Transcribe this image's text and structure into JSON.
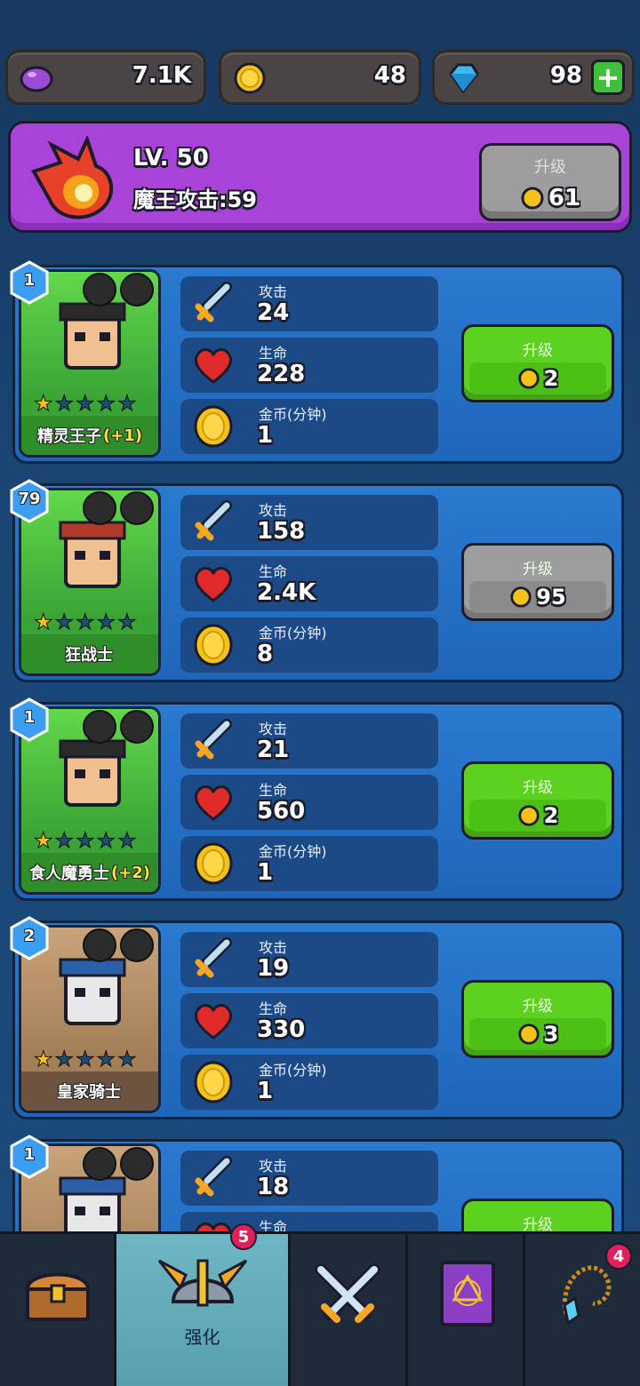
{
  "resources": {
    "purple": {
      "icon": "purple-orb-icon",
      "value": "7.1K"
    },
    "gold": {
      "icon": "gold-coin-icon",
      "value": "48"
    },
    "gems": {
      "icon": "diamond-icon",
      "value": "98",
      "add": "+"
    }
  },
  "boss_upgrade": {
    "level": "LV. 50",
    "attack_label": "魔王攻击:59",
    "button_label": "升级",
    "cost": "61"
  },
  "heroes": [
    {
      "badge": "1",
      "name": "精灵王子",
      "bonus": "(+1)",
      "stars_filled": 1,
      "stars_total": 5,
      "stats": {
        "atk_label": "攻击",
        "atk": "24",
        "hp_label": "生命",
        "hp": "228",
        "gold_label": "金币(分钟)",
        "gold": "1"
      },
      "upgrade_label": "升级",
      "cost": "2",
      "upgrade_enabled": true
    },
    {
      "badge": "79",
      "name": "狂战士",
      "bonus": "",
      "stars_filled": 1,
      "stars_total": 5,
      "stats": {
        "atk_label": "攻击",
        "atk": "158",
        "hp_label": "生命",
        "hp": "2.4K",
        "gold_label": "金币(分钟)",
        "gold": "8"
      },
      "upgrade_label": "升级",
      "cost": "95",
      "upgrade_enabled": false
    },
    {
      "badge": "1",
      "name": "食人魔勇士",
      "bonus": "(+2)",
      "stars_filled": 1,
      "stars_total": 5,
      "stats": {
        "atk_label": "攻击",
        "atk": "21",
        "hp_label": "生命",
        "hp": "560",
        "gold_label": "金币(分钟)",
        "gold": "1"
      },
      "upgrade_label": "升级",
      "cost": "2",
      "upgrade_enabled": true
    },
    {
      "badge": "2",
      "name": "皇家骑士",
      "bonus": "",
      "stars_filled": 1,
      "stars_total": 5,
      "stats": {
        "atk_label": "攻击",
        "atk": "19",
        "hp_label": "生命",
        "hp": "330",
        "gold_label": "金币(分钟)",
        "gold": "1"
      },
      "upgrade_label": "升级",
      "cost": "3",
      "upgrade_enabled": true
    },
    {
      "badge": "1",
      "name": "",
      "bonus": "",
      "stars_filled": 1,
      "stars_total": 5,
      "stats": {
        "atk_label": "攻击",
        "atk": "18",
        "hp_label": "生命",
        "hp": "",
        "gold_label": "",
        "gold": ""
      },
      "upgrade_label": "升级",
      "cost": "",
      "upgrade_enabled": true
    }
  ],
  "nav": {
    "tabs": [
      {
        "name": "treasure-chest-icon",
        "label": "",
        "badge": ""
      },
      {
        "name": "winged-helmet-icon",
        "label": "强化",
        "badge": "5"
      },
      {
        "name": "crossed-swords-icon",
        "label": "",
        "badge": ""
      },
      {
        "name": "spellbook-icon",
        "label": "",
        "badge": ""
      },
      {
        "name": "amulet-icon",
        "label": "",
        "badge": "4"
      }
    ]
  },
  "colors": {
    "accent_purple": "#a943d8",
    "button_green": "#5dd11f",
    "button_gray": "#9d9d9d",
    "card_blue": "#2a7ad0"
  }
}
